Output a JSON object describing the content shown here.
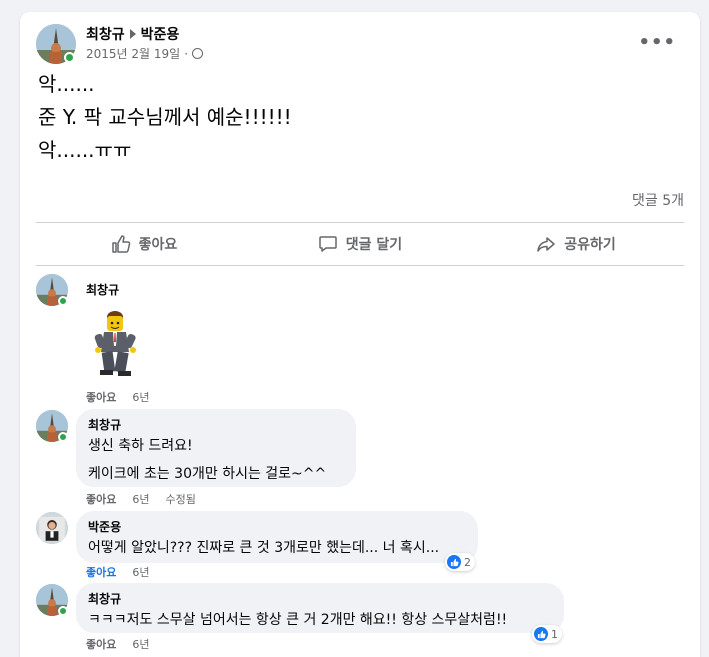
{
  "post": {
    "author": "최창규",
    "target": "박준용",
    "date": "2015년 2월 19일",
    "meta_separator": "·",
    "more_label": "•••",
    "lines": [
      "악......",
      "준 Y. 팍 교수님께서 예순!!!!!!",
      "악......ㅠㅠ"
    ],
    "comment_count": "댓글 5개"
  },
  "actions": {
    "like": "좋아요",
    "comment": "댓글 달기",
    "share": "공유하기"
  },
  "comments": [
    {
      "name": "최창규",
      "sticker": "lego-businessman-sticker",
      "like_label": "좋아요",
      "time": "6년"
    },
    {
      "name": "최창규",
      "line1": "생신 축하 드려요!",
      "line2": "케이크에 초는 30개만 하시는 걸로~^^",
      "like_label": "좋아요",
      "time": "6년",
      "edited": "수정됨"
    },
    {
      "name": "박준용",
      "text": "어떻게 알았니??? 진짜로 큰 것 3개로만 했는데... 너 혹시...",
      "like_label": "좋아요",
      "time": "6년",
      "reactions": "2"
    },
    {
      "name": "최창규",
      "text": "ㅋㅋㅋ저도 스무살 넘어서는 항상 큰 거 2개만 해요!! 항상 스무살처럼!!",
      "like_label": "좋아요",
      "time": "6년",
      "reactions": "1"
    }
  ],
  "colors": {
    "accent": "#1877f2",
    "online": "#31a24c",
    "secondary_text": "#65676b"
  }
}
